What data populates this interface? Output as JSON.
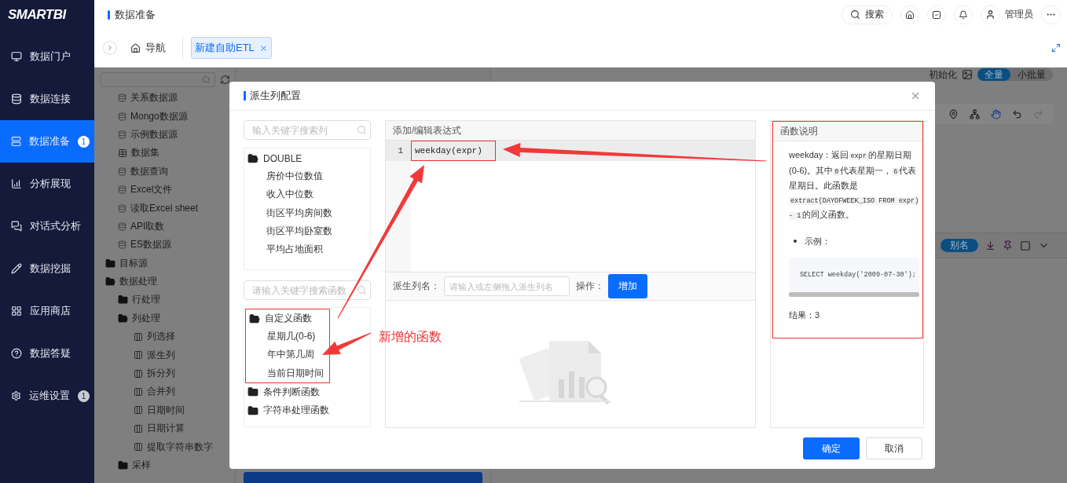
{
  "logo": "SMARTBI",
  "sidebar": {
    "items": [
      {
        "label": "数据门户",
        "selected": false
      },
      {
        "label": "数据连接",
        "selected": false
      },
      {
        "label": "数据准备",
        "selected": true,
        "badge": "1"
      },
      {
        "label": "分析展现",
        "selected": false
      },
      {
        "label": "对话式分析",
        "selected": false
      },
      {
        "label": "数据挖掘",
        "selected": false
      },
      {
        "label": "应用商店",
        "selected": false
      },
      {
        "label": "数据答疑",
        "selected": false
      },
      {
        "label": "运维设置",
        "selected": false,
        "badge": "1"
      }
    ]
  },
  "header": {
    "title": "数据准备",
    "search": "搜索",
    "user": "管理员"
  },
  "tabs": [
    {
      "label": "导航",
      "selected": false,
      "kind": "home"
    },
    {
      "label": "新建自助ETL",
      "selected": true,
      "kind": "closable"
    }
  ],
  "resource_tree": {
    "items": [
      {
        "label": "关系数据源",
        "kind": "source"
      },
      {
        "label": "Mongo数据源",
        "kind": "source"
      },
      {
        "label": "示例数据源",
        "kind": "source"
      },
      {
        "label": "数据集",
        "kind": "dataset"
      },
      {
        "label": "数据查询",
        "kind": "source"
      },
      {
        "label": "Excel文件",
        "kind": "source"
      },
      {
        "label": "读取Excel sheet",
        "kind": "source"
      },
      {
        "label": "API取数",
        "kind": "source"
      },
      {
        "label": "ES数据源",
        "kind": "source"
      },
      {
        "label": "目标源",
        "kind": "folder",
        "expanded": false
      },
      {
        "label": "数据处理",
        "kind": "folder",
        "expanded": true,
        "children": [
          {
            "label": "行处理",
            "kind": "folder",
            "expanded": false
          },
          {
            "label": "列处理",
            "kind": "folder",
            "expanded": true,
            "children": [
              {
                "label": "列选择",
                "kind": "op"
              },
              {
                "label": "派生列",
                "kind": "op"
              },
              {
                "label": "拆分列",
                "kind": "op"
              },
              {
                "label": "合并列",
                "kind": "op"
              },
              {
                "label": "日期时间",
                "kind": "op"
              },
              {
                "label": "日期计算",
                "kind": "op"
              },
              {
                "label": "提取字符串数字",
                "kind": "op"
              }
            ]
          },
          {
            "label": "采样",
            "kind": "folder",
            "expanded": false
          }
        ]
      }
    ]
  },
  "canvas_toolbar": {
    "init": "初始化",
    "modes": [
      {
        "label": "全量",
        "selected": true
      },
      {
        "label": "小批量",
        "selected": false
      }
    ]
  },
  "property_panel": {
    "alias": "别名"
  },
  "dialog": {
    "title": "派生列配置",
    "column_search": {
      "placeholder": "输入关键字搜索列"
    },
    "columns": [
      {
        "label": "DOUBLE",
        "expanded": true,
        "children": [
          {
            "label": "房价中位数值"
          },
          {
            "label": "收入中位数"
          },
          {
            "label": "街区平均房间数"
          },
          {
            "label": "街区平均卧室数"
          },
          {
            "label": "平均占地面积"
          }
        ]
      }
    ],
    "function_search": {
      "placeholder": "请输入关键字搜索函数"
    },
    "functions": [
      {
        "label": "自定义函数",
        "expanded": true,
        "highlighted": true,
        "children": [
          {
            "label": "星期几(0-6)"
          },
          {
            "label": "年中第几周"
          },
          {
            "label": "当前日期时间"
          }
        ]
      },
      {
        "label": "条件判断函数",
        "expanded": false,
        "highlighted": false
      },
      {
        "label": "字符串处理函数",
        "expanded": false,
        "highlighted": false
      }
    ],
    "editor": {
      "header": "添加/编辑表达式",
      "lines": [
        {
          "number": "1",
          "code": "weekday(expr)",
          "highlighted": true
        }
      ]
    },
    "name_field": {
      "label": "派生列名：",
      "placeholder": "请输入或左侧拖入派生列名"
    },
    "operation_label": "操作：",
    "add_button": "增加",
    "help": {
      "title": "函数说明",
      "description": [
        {
          "kind": "text",
          "text": "weekday：返回"
        },
        {
          "kind": "code",
          "text": "expr"
        },
        {
          "kind": "text",
          "text": "的星期日期(0-6)。其中"
        },
        {
          "kind": "code",
          "text": "0"
        },
        {
          "kind": "text",
          "text": "代表星期一，"
        },
        {
          "kind": "code",
          "text": "6"
        },
        {
          "kind": "text",
          "text": "代表星期日。此函数是"
        },
        {
          "kind": "code",
          "text": "extract(DAYOFWEEK_ISO FROM expr) - 1"
        },
        {
          "kind": "text",
          "text": "的同义函数。"
        }
      ],
      "example_label": "示例：",
      "example_code": "SELECT weekday('2009-07-30');",
      "result": "结果：3"
    },
    "buttons": [
      {
        "label": "确定",
        "kind": "primary"
      },
      {
        "label": "取消",
        "kind": "default"
      }
    ]
  },
  "annotation": {
    "label": "新增的函数"
  }
}
